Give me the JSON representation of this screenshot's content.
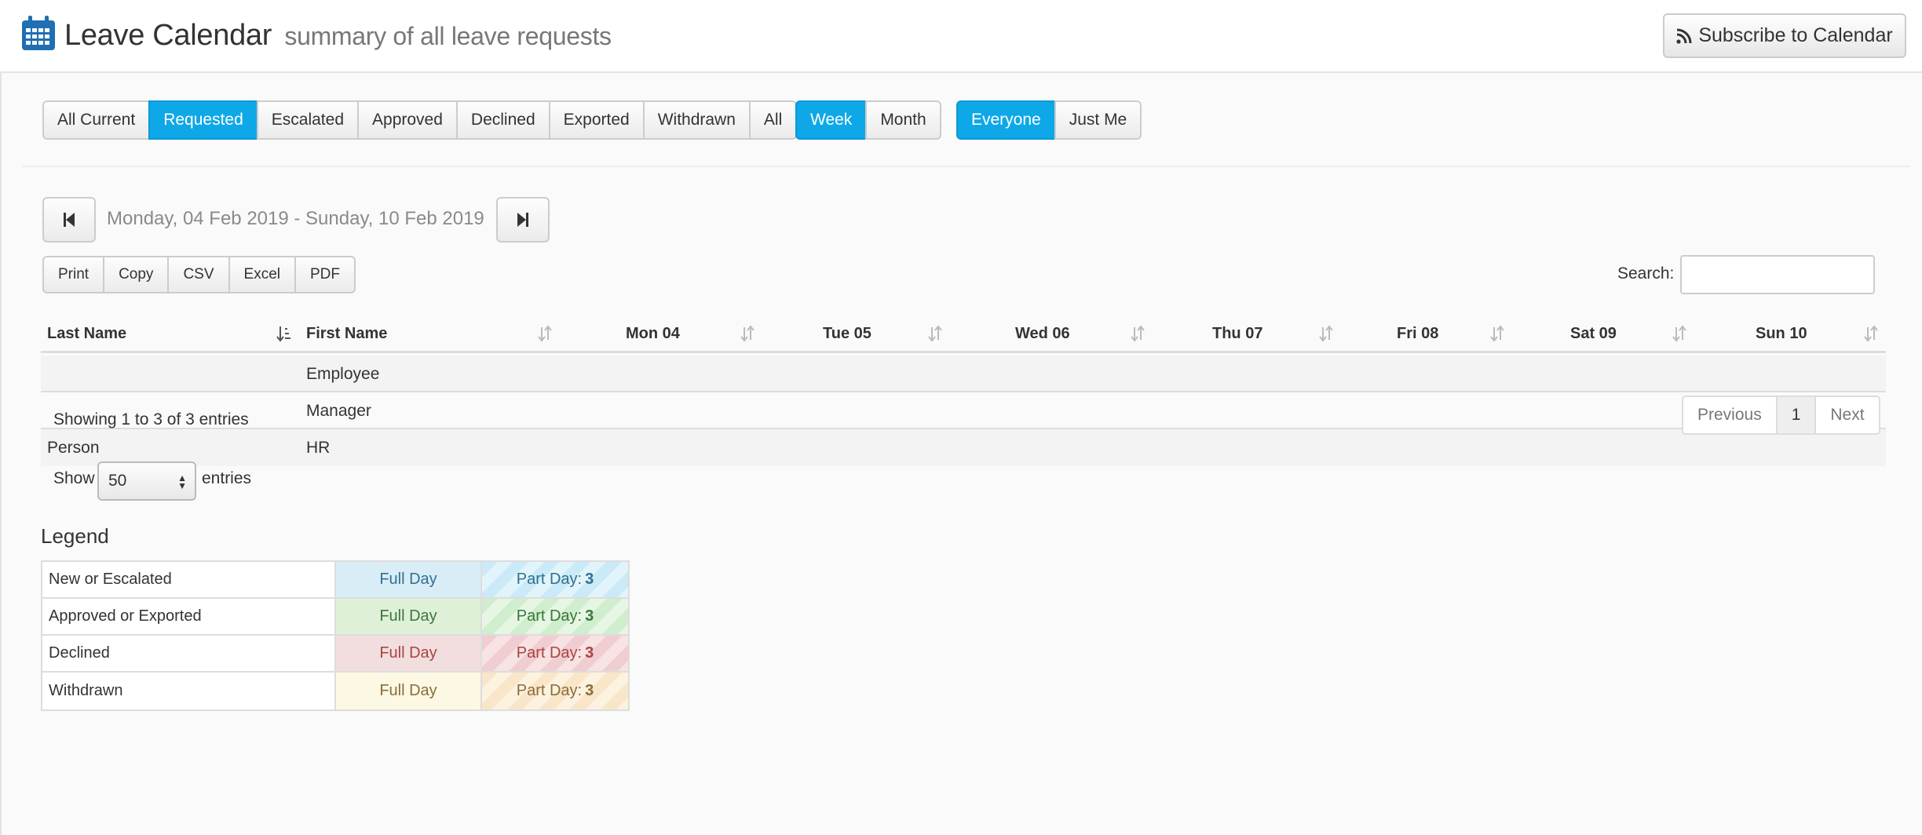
{
  "header": {
    "title": "Leave Calendar",
    "subtitle": "summary of all leave requests",
    "subscribe_label": "Subscribe to Calendar"
  },
  "filters": {
    "status": [
      {
        "label": "All Current",
        "active": false
      },
      {
        "label": "Requested",
        "active": true
      },
      {
        "label": "Escalated",
        "active": false
      },
      {
        "label": "Approved",
        "active": false
      },
      {
        "label": "Declined",
        "active": false
      },
      {
        "label": "Exported",
        "active": false
      },
      {
        "label": "Withdrawn",
        "active": false
      },
      {
        "label": "All",
        "active": false
      }
    ],
    "period": [
      {
        "label": "Week",
        "active": true
      },
      {
        "label": "Month",
        "active": false
      }
    ],
    "scope": [
      {
        "label": "Everyone",
        "active": true
      },
      {
        "label": "Just Me",
        "active": false
      }
    ]
  },
  "date_range": "Monday, 04 Feb 2019 - Sunday, 10 Feb 2019",
  "export_buttons": [
    "Print",
    "Copy",
    "CSV",
    "Excel",
    "PDF"
  ],
  "search": {
    "label": "Search:",
    "value": ""
  },
  "table": {
    "columns": [
      "Last Name",
      "First Name",
      "Mon 04",
      "Tue 05",
      "Wed 06",
      "Thu 07",
      "Fri 08",
      "Sat 09",
      "Sun 10"
    ],
    "rows": [
      {
        "last_name": "",
        "first_name": "Employee"
      },
      {
        "last_name": "",
        "first_name": "Manager"
      },
      {
        "last_name": "Person",
        "first_name": "HR"
      }
    ]
  },
  "info": "Showing 1 to 3 of 3 entries",
  "pagination": {
    "previous": "Previous",
    "current": "1",
    "next": "Next"
  },
  "length": {
    "show_label": "Show",
    "value": "50",
    "entries_label": "entries"
  },
  "legend": {
    "title": "Legend",
    "full_day_label": "Full Day",
    "part_day_label": "Part Day:",
    "part_day_count": "3",
    "rows": [
      {
        "name": "New or Escalated",
        "color": "#31708f",
        "bg": "#d9edf7"
      },
      {
        "name": "Approved or Exported",
        "color": "#3c763d",
        "bg": "#dff0d8"
      },
      {
        "name": "Declined",
        "color": "#a94442",
        "bg": "#f2dede"
      },
      {
        "name": "Withdrawn",
        "color": "#8a6d3b",
        "bg": "#fcf8e3"
      }
    ]
  }
}
